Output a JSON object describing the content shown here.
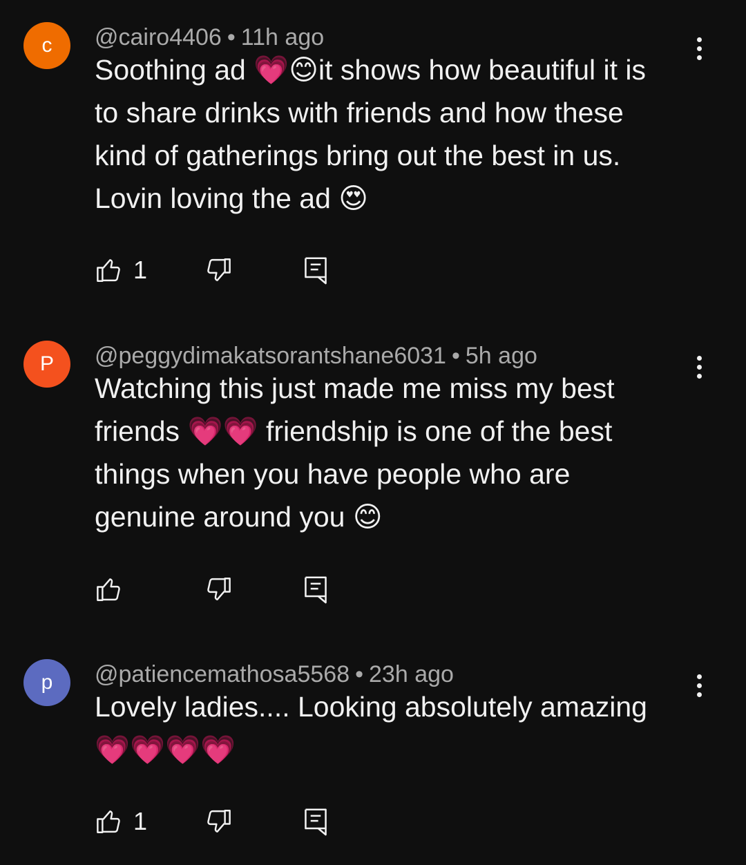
{
  "comments": [
    {
      "avatar_letter": "c",
      "avatar_color": "#ef6c00",
      "handle": "@cairo4406",
      "time": "11h ago",
      "text": "Soothing  ad 💗😊it shows how beautiful it is\nto share drinks with friends and how these\nkind of gatherings bring out the best in us.\nLovin loving the ad 😍",
      "like_count": "1",
      "icons": {
        "like": "thumbs-up-icon",
        "dislike": "thumbs-down-icon",
        "reply": "reply-icon",
        "more": "more-vertical-icon"
      }
    },
    {
      "avatar_letter": "P",
      "avatar_color": "#f4511e",
      "handle": "@peggydimakatsorantshane6031",
      "time": "5h ago",
      "text": "Watching this just made me miss my best\nfriends 💗💗 friendship is one of the best\nthings when you have people who are\ngenuine around you 😊",
      "like_count": "",
      "icons": {
        "like": "thumbs-up-icon",
        "dislike": "thumbs-down-icon",
        "reply": "reply-icon",
        "more": "more-vertical-icon"
      }
    },
    {
      "avatar_letter": "p",
      "avatar_color": "#5c6bc0",
      "handle": "@patiencemathosa5568",
      "time": "23h ago",
      "text": "Lovely ladies.... Looking absolutely amazing\n💗💗💗💗",
      "like_count": "1",
      "icons": {
        "like": "thumbs-up-icon",
        "dislike": "thumbs-down-icon",
        "reply": "reply-icon",
        "more": "more-vertical-icon"
      }
    }
  ],
  "separator": "•"
}
